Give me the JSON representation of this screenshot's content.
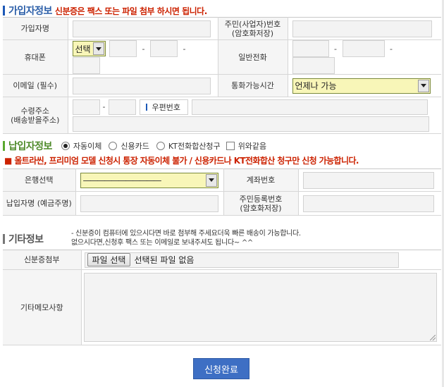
{
  "colors": {
    "section_bar": "#1d59b7",
    "section_text": "#2b5ea8",
    "note_red": "#cc2200",
    "submit_bg": "#3e6fc4"
  },
  "subscriber": {
    "title": "가입자정보",
    "note": "신분증은 팩스 또는 파일 첨부 하시면 됩니다.",
    "name_label": "가입자명",
    "resident_label_1": "주민(사업자)번호",
    "resident_label_2": "(암호화저장)",
    "mobile_label": "휴대폰",
    "mobile_select": "선택",
    "phone_label": "일반전화",
    "email_label": "이메일 (필수)",
    "calltime_label": "통화가능시간",
    "calltime_select": "언제나 가능",
    "address_label_1": "수령주소",
    "address_label_2": "(배송받을주소)",
    "zip_button": "우편번호",
    "dash": "-"
  },
  "payer": {
    "title": "납입자정보",
    "options": [
      "자동이체",
      "신용카드",
      "KT전화합산청구"
    ],
    "selected": "자동이체",
    "same_as_above": "위와같음",
    "warning": "■ 울트라씬, 프리미엄 모델 신청시 통장 자동이체 불가 / 신용카드나 KT전화합산 청구만 신청 가능합니다.",
    "bank_label": "은행선택",
    "bank_select": "———————————",
    "account_label": "계좌번호",
    "payer_name_label": "납입자명 (예금주명)",
    "resident_label_1": "주민등록번호",
    "resident_label_2": "(암호화저장)"
  },
  "other": {
    "title": "기타정보",
    "info_line1": "- 신분증이 컴퓨터에 있으시다면 바로 첨부해 주세요더욱 빠른 배송이 가능합니다.",
    "info_line2": "없으시다면,신청후 팩스 또는 이메일로 보내주셔도 됩니다~ ^^",
    "id_attach_label": "신분증첨부",
    "file_button": "파일 선택",
    "file_status": "선택된 파일 없음",
    "memo_label": "기타메모사항"
  },
  "submit_label": "신청완료"
}
